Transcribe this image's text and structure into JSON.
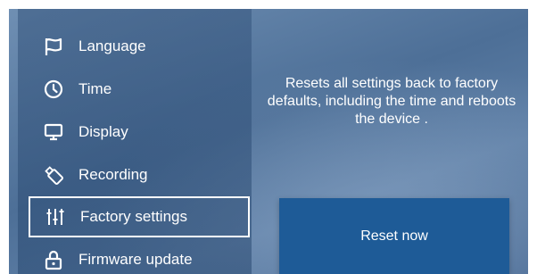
{
  "menu": {
    "items": [
      {
        "label": "",
        "icon": "partial-top-icon"
      },
      {
        "label": "Language",
        "icon": "flag-icon"
      },
      {
        "label": "Time",
        "icon": "clock-icon"
      },
      {
        "label": "Display",
        "icon": "monitor-icon"
      },
      {
        "label": "Recording",
        "icon": "usb-drive-icon"
      },
      {
        "label": "Factory settings",
        "icon": "sliders-icon",
        "selected": true
      },
      {
        "label": "Firmware update",
        "icon": "lock-icon"
      }
    ]
  },
  "panel": {
    "description": "Resets all settings back to factory defaults, including the time and reboots the device .",
    "reset_button_label": "Reset now"
  },
  "colors": {
    "button_blue": "#1e5b97",
    "background": "#4d6f97"
  }
}
